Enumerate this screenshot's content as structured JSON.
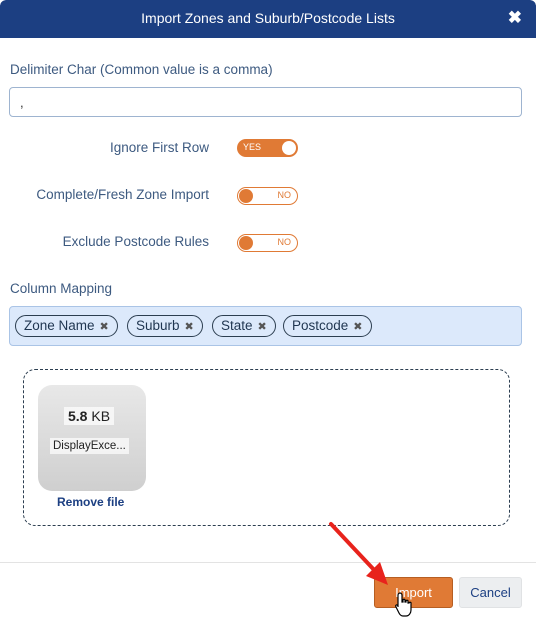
{
  "dialog": {
    "title": "Import Zones and Suburb/Postcode Lists",
    "close_icon": "close-icon",
    "close_glyph": "✖"
  },
  "delimiter": {
    "label": "Delimiter Char (Common value is a comma)",
    "value": ","
  },
  "toggles": [
    {
      "label": "Ignore First Row",
      "state": "YES",
      "on": true
    },
    {
      "label": "Complete/Fresh Zone Import",
      "state": "NO",
      "on": false
    },
    {
      "label": "Exclude Postcode Rules",
      "state": "NO",
      "on": false
    }
  ],
  "column_mapping": {
    "label": "Column Mapping",
    "tags": [
      "Zone Name",
      "Suburb",
      "State",
      "Postcode"
    ],
    "remove_glyph": "✖"
  },
  "file": {
    "size_value": "5.8",
    "size_unit": "KB",
    "name": "DisplayExce...",
    "remove_label": "Remove file"
  },
  "footer": {
    "import_label": "Import",
    "cancel_label": "Cancel"
  },
  "colors": {
    "header": "#1c3f82",
    "accent": "#e07a35",
    "label_text": "#3d5a80",
    "mapping_bg": "#dce9fb",
    "annotation_arrow": "#e8231c"
  }
}
